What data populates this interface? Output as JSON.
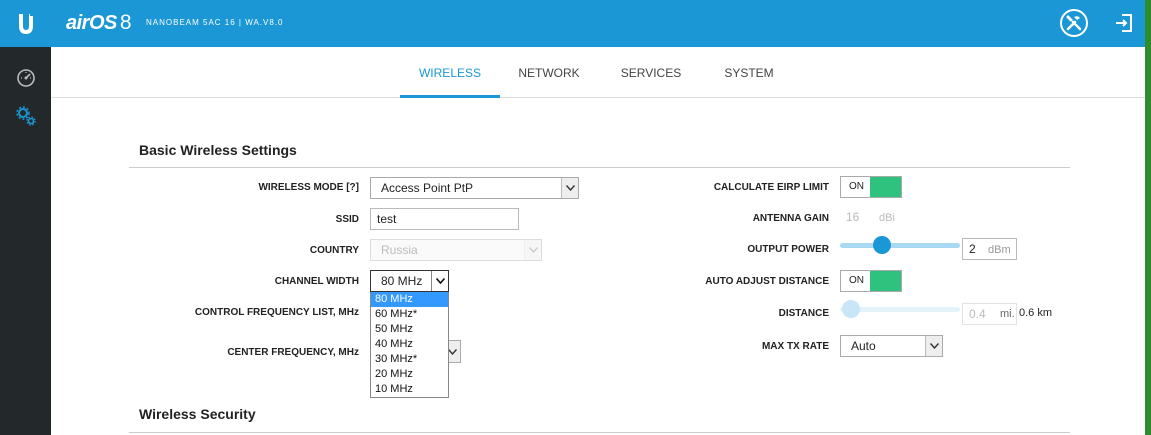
{
  "brand": {
    "name": "airOS",
    "version": "8",
    "device": "NANOBEAM 5AC 16 | WA.V8.0"
  },
  "tabs": [
    {
      "label": "WIRELESS",
      "active": true
    },
    {
      "label": "NETWORK",
      "active": false
    },
    {
      "label": "SERVICES",
      "active": false
    },
    {
      "label": "SYSTEM",
      "active": false
    }
  ],
  "sections": {
    "basic": "Basic Wireless Settings",
    "security": "Wireless Security"
  },
  "left": {
    "wireless_mode": {
      "label": "WIRELESS MODE [?]",
      "value": "Access Point PtP"
    },
    "ssid": {
      "label": "SSID",
      "value": "test"
    },
    "country": {
      "label": "COUNTRY",
      "value": "Russia"
    },
    "channel_width": {
      "label": "CHANNEL WIDTH",
      "value": "80 MHz"
    },
    "control_freq": {
      "label": "CONTROL FREQUENCY LIST, MHz"
    },
    "center_freq": {
      "label": "CENTER FREQUENCY, MHz"
    }
  },
  "channel_width_options": [
    "80 MHz",
    "60 MHz*",
    "50 MHz",
    "40 MHz",
    "30 MHz*",
    "20 MHz",
    "10 MHz"
  ],
  "right": {
    "eirp": {
      "label": "CALCULATE EIRP LIMIT",
      "state": "ON"
    },
    "antenna_gain": {
      "label": "ANTENNA GAIN",
      "value": "16",
      "unit": "dBi"
    },
    "output_power": {
      "label": "OUTPUT POWER",
      "value": "2",
      "unit": "dBm",
      "level": 0.35
    },
    "auto_distance": {
      "label": "AUTO ADJUST DISTANCE",
      "state": "ON"
    },
    "distance": {
      "label": "DISTANCE",
      "value": "0.4",
      "unit": "mi.",
      "km": "0.6 km"
    },
    "max_tx_rate": {
      "label": "MAX TX RATE",
      "value": "Auto"
    }
  },
  "colors": {
    "brand_blue": "#1a97d4",
    "sidebar": "#23282b",
    "toggle_on": "#2ec27e",
    "green_edge": "#2e8b2e"
  },
  "icons": {
    "logo": "ubiquiti-u-icon",
    "tools": "tools-icon",
    "logout": "logout-icon",
    "dashboard": "dashboard-icon",
    "settings": "settings-gears-icon"
  }
}
